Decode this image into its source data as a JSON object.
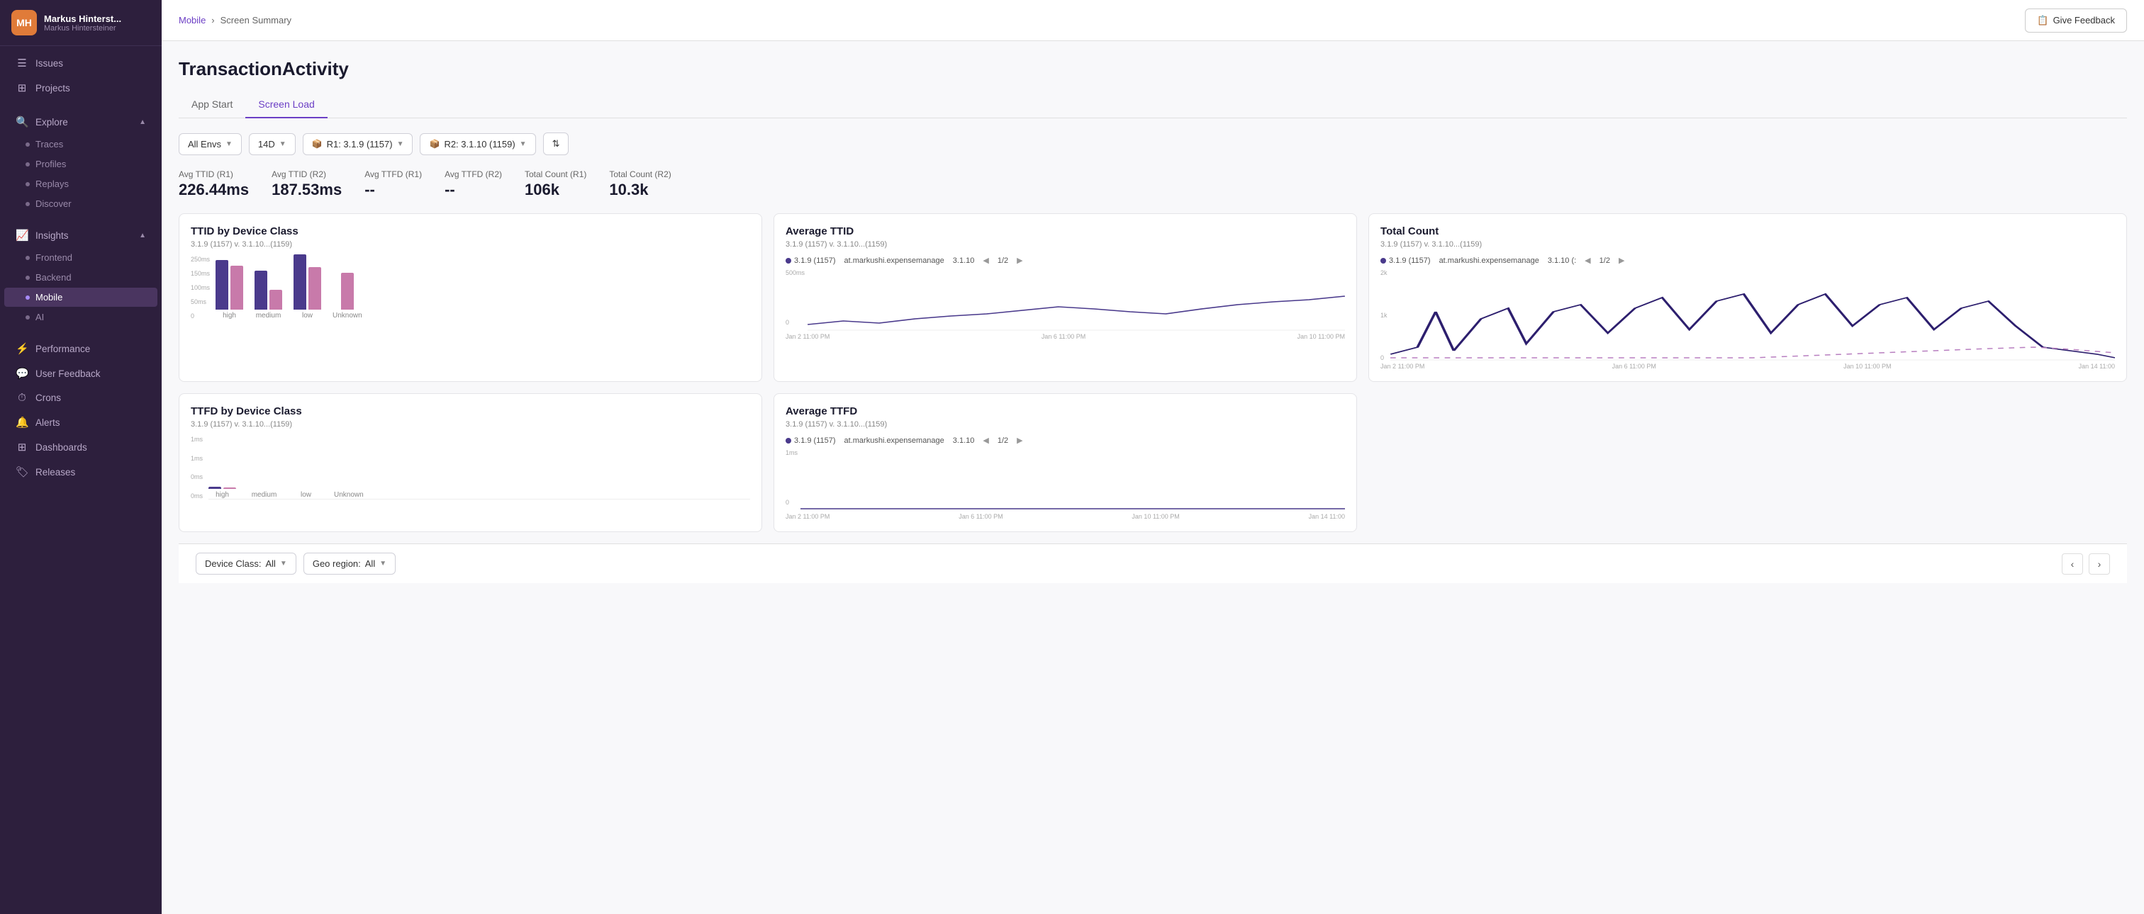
{
  "sidebar": {
    "user_initials": "MH",
    "user_name": "Markus Hinterst...",
    "user_sub": "Markus Hintersteiner",
    "nav": {
      "issues_label": "Issues",
      "projects_label": "Projects",
      "explore_label": "Explore",
      "traces_label": "Traces",
      "profiles_label": "Profiles",
      "replays_label": "Replays",
      "discover_label": "Discover",
      "insights_label": "Insights",
      "frontend_label": "Frontend",
      "backend_label": "Backend",
      "mobile_label": "Mobile",
      "ai_label": "AI",
      "performance_label": "Performance",
      "user_feedback_label": "User Feedback",
      "crons_label": "Crons",
      "alerts_label": "Alerts",
      "dashboards_label": "Dashboards",
      "releases_label": "Releases"
    }
  },
  "topbar": {
    "breadcrumb_root": "Mobile",
    "breadcrumb_sep": "›",
    "breadcrumb_current": "Screen Summary",
    "feedback_btn": "Give Feedback"
  },
  "page": {
    "title": "TransactionActivity",
    "tabs": [
      "App Start",
      "Screen Load"
    ],
    "active_tab": "Screen Load"
  },
  "filters": {
    "env_label": "All Envs",
    "time_label": "14D",
    "r1_label": "R1:  3.1.9 (1157)",
    "r2_label": "R2:  3.1.10 (1159)",
    "swap_icon": "⇅"
  },
  "metrics": [
    {
      "label": "Avg TTID (R1)",
      "value": "226.44ms"
    },
    {
      "label": "Avg TTID (R2)",
      "value": "187.53ms"
    },
    {
      "label": "Avg TTFD (R1)",
      "value": "--"
    },
    {
      "label": "Avg TTFD (R2)",
      "value": "--"
    },
    {
      "label": "Total Count (R1)",
      "value": "106k"
    },
    {
      "label": "Total Count (R2)",
      "value": "10.3k"
    }
  ],
  "chart_ttid": {
    "title": "TTID by Device Class",
    "subtitle": "3.1.9 (1157) v. 3.1.10...(1159)",
    "bars": [
      {
        "group": "high",
        "r1_height": 70,
        "r2_height": 62,
        "r1_color": "#4a3a8c",
        "r2_color": "#c87aaa"
      },
      {
        "group": "medium",
        "r1_height": 55,
        "r2_height": 28,
        "r1_color": "#4a3a8c",
        "r2_color": "#c87aaa"
      },
      {
        "group": "low",
        "r1_height": 78,
        "r2_height": 60,
        "r1_color": "#4a3a8c",
        "r2_color": "#c87aaa"
      },
      {
        "group": "Unknown",
        "r1_height": 52,
        "r2_height": 0,
        "r1_color": "#c87aaa",
        "r2_color": "#c87aaa"
      }
    ],
    "y_labels": [
      "250ms",
      "150ms",
      "100ms",
      "50ms",
      "0"
    ]
  },
  "chart_avg_ttid": {
    "title": "Average TTID",
    "subtitle": "3.1.9 (1157) v. 3.1.10...(1159)",
    "legend": [
      "3.1.9 (1157)",
      "at.markushi.expensemanage",
      "3.1.10"
    ],
    "page": "1/2",
    "y_max": "500ms",
    "y_min": "0",
    "x_labels": [
      "Jan 2 11:00 PM",
      "Jan 6 11:00 PM",
      "Jan 10 11:00 PM"
    ]
  },
  "chart_total_count": {
    "title": "Total Count",
    "subtitle": "3.1.9 (1157) v. 3.1.10...(1159)",
    "legend": [
      "3.1.9 (1157)",
      "at.markushi.expensemanage",
      "3.1.10 (:"
    ],
    "page": "1/2",
    "y_labels": [
      "2k",
      "1k",
      "0"
    ],
    "x_labels": [
      "Jan 2 11:00 PM",
      "Jan 6 11:00 PM",
      "Jan 10 11:00 PM",
      "Jan 14 11:00"
    ]
  },
  "chart_ttfd": {
    "title": "TTFD by Device Class",
    "subtitle": "3.1.9 (1157) v. 3.1.10...(1159)",
    "y_labels": [
      "1ms",
      "1ms",
      "0ms",
      "0ms"
    ],
    "groups": [
      "high",
      "medium",
      "low",
      "Unknown"
    ]
  },
  "chart_avg_ttfd": {
    "title": "Average TTFD",
    "subtitle": "3.1.9 (1157) v. 3.1.10...(1159)",
    "legend": [
      "3.1.9 (1157)",
      "at.markushi.expensemanage",
      "3.1.10"
    ],
    "page": "1/2",
    "y_max": "1ms",
    "y_min": "0",
    "x_labels": [
      "Jan 2 11:00 PM",
      "Jan 6 11:00 PM",
      "Jan 10 11:00 PM",
      "Jan 14 11:00"
    ]
  },
  "bottom": {
    "device_class_label": "Device Class:",
    "device_class_value": "All",
    "geo_label": "Geo region:",
    "geo_value": "All"
  }
}
